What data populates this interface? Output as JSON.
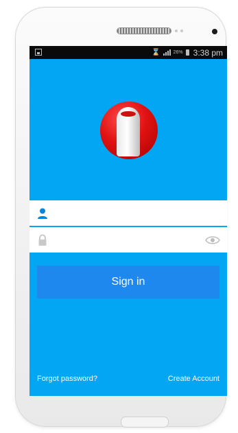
{
  "status_bar": {
    "battery_percent": "26%",
    "time": "3:38 pm"
  },
  "login": {
    "username_placeholder": "",
    "password_placeholder": "",
    "sign_in_label": "Sign in",
    "forgot_password_label": "Forgot password?",
    "create_account_label": "Create Account"
  },
  "icons": {
    "status_left": "gallery-icon",
    "hourglass": "hourglass-icon",
    "signal": "signal-icon",
    "battery": "battery-icon",
    "user": "user-icon",
    "lock": "lock-icon",
    "eye": "eye-icon",
    "logo": "app-logo"
  },
  "colors": {
    "screen_background": "#02a6f2",
    "sign_in_button": "#1e88ef",
    "field_icon_blue": "#0a84d6",
    "logo_red": "#e01212"
  }
}
